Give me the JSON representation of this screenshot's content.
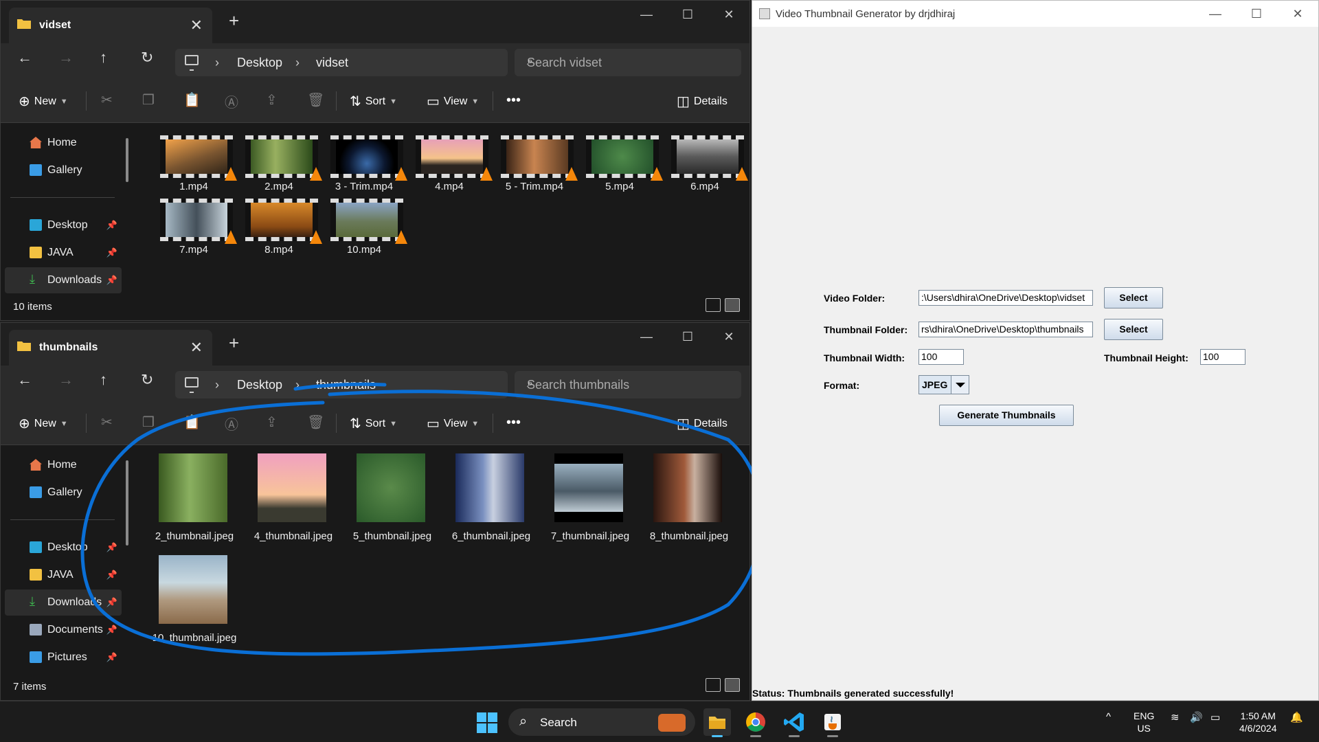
{
  "explorer_top": {
    "tab_title": "vidset",
    "address": [
      "Desktop",
      "vidset"
    ],
    "search_placeholder": "Search vidset",
    "commands": {
      "new": "New",
      "sort": "Sort",
      "view": "View",
      "details": "Details"
    },
    "nav": [
      {
        "label": "Home"
      },
      {
        "label": "Gallery"
      },
      {
        "label": "Desktop"
      },
      {
        "label": "JAVA"
      },
      {
        "label": "Downloads"
      }
    ],
    "files": [
      "1.mp4",
      "2.mp4",
      "3 - Trim.mp4",
      "4.mp4",
      "5 - Trim.mp4",
      "5.mp4",
      "6.mp4",
      "7.mp4",
      "8.mp4",
      "10.mp4"
    ],
    "status": "10 items"
  },
  "explorer_bottom": {
    "tab_title": "thumbnails",
    "address": [
      "Desktop",
      "thumbnails"
    ],
    "search_placeholder": "Search thumbnails",
    "commands": {
      "new": "New",
      "sort": "Sort",
      "view": "View",
      "details": "Details"
    },
    "nav": [
      {
        "label": "Home"
      },
      {
        "label": "Gallery"
      },
      {
        "label": "Desktop"
      },
      {
        "label": "JAVA"
      },
      {
        "label": "Downloads"
      },
      {
        "label": "Documents"
      },
      {
        "label": "Pictures"
      }
    ],
    "files": [
      "2_thumbnail.jpeg",
      "4_thumbnail.jpeg",
      "5_thumbnail.jpeg",
      "6_thumbnail.jpeg",
      "7_thumbnail.jpeg",
      "8_thumbnail.jpeg",
      "10_thumbnail.jpeg"
    ],
    "status": "7 items"
  },
  "java_app": {
    "title": "Video Thumbnail Generator by drjdhiraj",
    "video_folder_label": "Video Folder:",
    "video_folder_value": ":\\Users\\dhira\\OneDrive\\Desktop\\vidset",
    "thumb_folder_label": "Thumbnail Folder:",
    "thumb_folder_value": "rs\\dhira\\OneDrive\\Desktop\\thumbnails",
    "select_label": "Select",
    "width_label": "Thumbnail Width:",
    "width_value": "100",
    "height_label": "Thumbnail Height:",
    "height_value": "100",
    "format_label": "Format:",
    "format_value": "JPEG",
    "generate_label": "Generate Thumbnails",
    "status": "Status: Thumbnails generated successfully!"
  },
  "taskbar": {
    "search_label": "Search",
    "lang": "ENG",
    "region": "US",
    "time": "1:50 AM",
    "date": "4/6/2024"
  },
  "colors": {
    "accent": "#4cc2ff",
    "annotation": "#0a6fd6",
    "folder": "#f2c141"
  }
}
